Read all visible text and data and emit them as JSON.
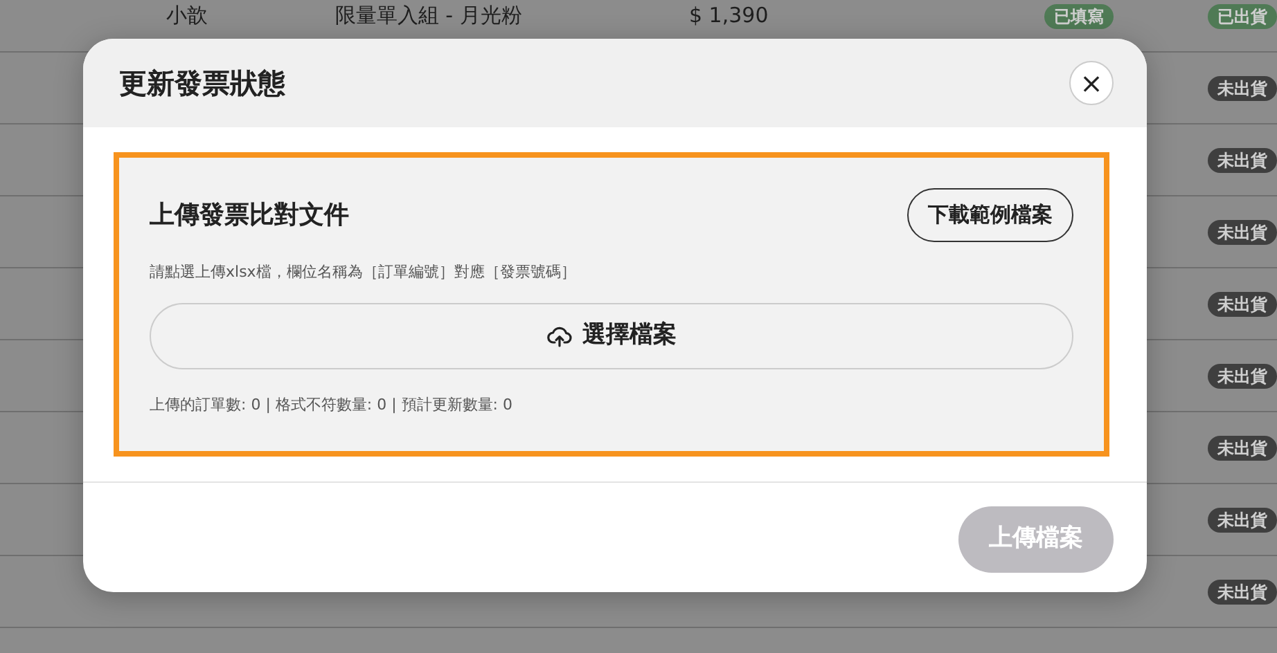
{
  "background_table": {
    "rows": [
      {
        "customer": "小歆",
        "product": "限量單入組 - 月光粉",
        "price": "$ 1,390",
        "fill_status": {
          "label": "已填寫",
          "color": "#4f7a55"
        },
        "ship_status": {
          "label": "已出貨",
          "color": "#4f7a55"
        }
      },
      {
        "ship_status": {
          "label": "未出貨",
          "color": "#3f3f3f"
        }
      },
      {
        "ship_status": {
          "label": "未出貨",
          "color": "#3f3f3f"
        }
      },
      {
        "ship_status": {
          "label": "未出貨",
          "color": "#3f3f3f"
        }
      },
      {
        "ship_status": {
          "label": "未出貨",
          "color": "#3f3f3f"
        }
      },
      {
        "ship_status": {
          "label": "未出貨",
          "color": "#3f3f3f"
        }
      },
      {
        "ship_status": {
          "label": "未出貨",
          "color": "#3f3f3f"
        }
      },
      {
        "ship_status": {
          "label": "未出貨",
          "color": "#3f3f3f"
        }
      },
      {
        "ship_status": {
          "label": "未出貨",
          "color": "#3f3f3f"
        }
      }
    ]
  },
  "modal": {
    "title": "更新發票狀態",
    "close": "×",
    "section": {
      "heading": "上傳發票比對文件",
      "download_button": "下載範例檔案",
      "hint": "請點選上傳xlsx檔，欄位名稱為［訂單編號］對應［發票號碼］",
      "choose_button": "選擇檔案",
      "counts": "上傳的訂單數: 0 | 格式不符數量: 0 | 預計更新數量: 0"
    },
    "upload_button": {
      "label": "上傳檔案",
      "disabled": true
    }
  }
}
